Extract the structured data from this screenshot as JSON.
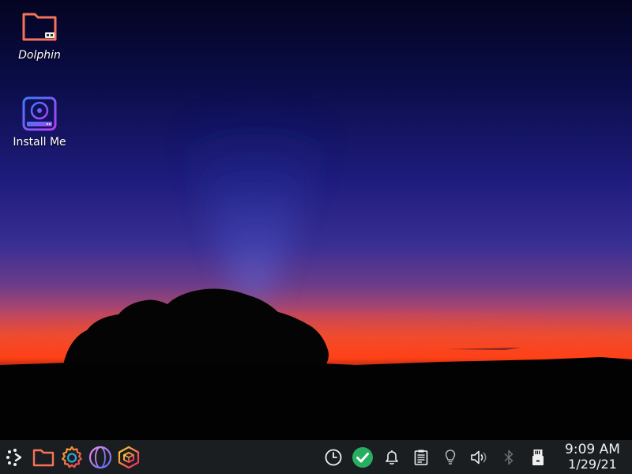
{
  "desktop": {
    "icons": [
      {
        "label": "Dolphin",
        "icon": "folder-icon"
      },
      {
        "label": "Install Me",
        "icon": "installer-disc-icon"
      }
    ]
  },
  "taskbar": {
    "launchers": [
      {
        "icon": "application-launcher-icon"
      },
      {
        "icon": "dolphin-folder-icon"
      },
      {
        "icon": "system-settings-gear-icon"
      },
      {
        "icon": "web-browser-globe-icon"
      },
      {
        "icon": "package-manager-icon"
      }
    ],
    "tray": [
      {
        "icon": "clock-icon"
      },
      {
        "icon": "updates-check-icon",
        "color": "#27ae60"
      },
      {
        "icon": "notifications-bell-icon"
      },
      {
        "icon": "clipboard-icon"
      },
      {
        "icon": "night-color-bulb-icon"
      },
      {
        "icon": "volume-icon"
      },
      {
        "icon": "bluetooth-icon"
      },
      {
        "icon": "storage-device-icon"
      }
    ],
    "clock": {
      "time": "9:09 AM",
      "date": "1/29/21"
    }
  },
  "colors": {
    "panel": "#1b1e20",
    "folder": "#f67359",
    "accent_green": "#27ae60"
  }
}
